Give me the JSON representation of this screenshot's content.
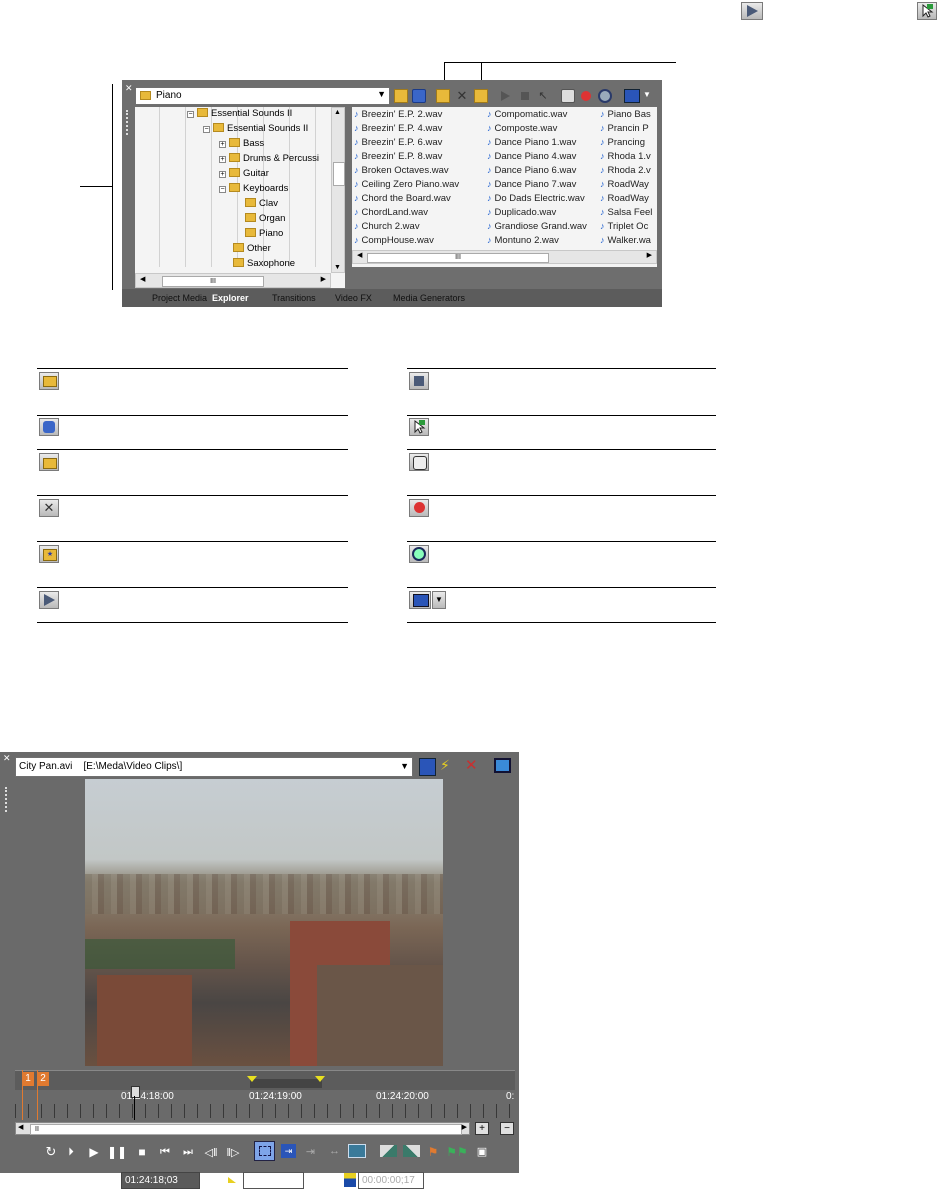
{
  "top_icons": {
    "play": "play-icon",
    "marker": "marker-cursor-icon"
  },
  "explorer": {
    "folder_combo": "Piano",
    "tree": [
      {
        "label": "Essential Sounds II",
        "expanded": true
      },
      {
        "label": "Essential Sounds II",
        "expanded": true
      },
      {
        "label": "Bass",
        "expanded": false
      },
      {
        "label": "Drums & Percussi",
        "expanded": false
      },
      {
        "label": "Guitar",
        "expanded": false
      },
      {
        "label": "Keyboards",
        "expanded": true
      },
      {
        "label": "Clav"
      },
      {
        "label": "Organ"
      },
      {
        "label": "Piano"
      },
      {
        "label": "Other"
      },
      {
        "label": "Saxophone"
      }
    ],
    "files_col1": [
      "Breezin' E.P. 2.wav",
      "Breezin' E.P. 4.wav",
      "Breezin' E.P. 6.wav",
      "Breezin' E.P. 8.wav",
      "Broken Octaves.wav",
      "Ceiling Zero Piano.wav",
      "Chord the Board.wav",
      "ChordLand.wav",
      "Church 2.wav",
      "CompHouse.wav"
    ],
    "files_col2": [
      "Compomatic.wav",
      "Composte.wav",
      "Dance Piano 1.wav",
      "Dance Piano 4.wav",
      "Dance Piano 6.wav",
      "Dance Piano 7.wav",
      "Do Dads Electric.wav",
      "Duplicado.wav",
      "Grandiose Grand.wav",
      "Montuno 2.wav"
    ],
    "files_col3": [
      "Piano Bas",
      "Prancin P",
      "Prancing",
      "Rhoda 1.v",
      "Rhoda 2.v",
      "RoadWay",
      "RoadWay",
      "Salsa Feel",
      "Triplet Oc",
      "Walker.wa"
    ],
    "tabs": [
      "Project Media",
      "Explorer",
      "Transitions",
      "Video FX",
      "Media Generators"
    ],
    "active_tab": "Explorer",
    "scroll_grip": "III"
  },
  "legend": {
    "left": [
      {
        "icon": "up-folder-icon"
      },
      {
        "icon": "refresh-icon"
      },
      {
        "icon": "new-folder-icon"
      },
      {
        "icon": "delete-icon"
      },
      {
        "icon": "favorites-folder-icon"
      },
      {
        "icon": "play-icon"
      }
    ],
    "right": [
      {
        "icon": "stop-icon"
      },
      {
        "icon": "auto-preview-icon"
      },
      {
        "icon": "get-media-icon"
      },
      {
        "icon": "record-icon"
      },
      {
        "icon": "search-media-icon"
      },
      {
        "icon": "views-icon"
      }
    ]
  },
  "trimmer": {
    "media_combo": "City Pan.avi    [E:\\Meda\\Video Clips\\]",
    "markers": [
      "1",
      "2"
    ],
    "ruler_labels": [
      "01:24:18:00",
      "01:24:19:00",
      "01:24:20:00",
      "0:"
    ],
    "time_current": "01:24:18;03",
    "time_selection": "00:00:00;17",
    "scroll_grip": "II"
  }
}
